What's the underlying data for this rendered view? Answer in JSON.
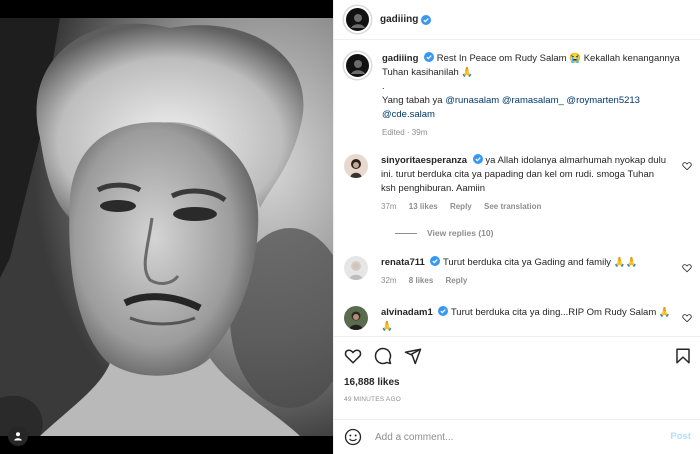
{
  "post": {
    "username": "gadiiing",
    "photo_description_icon": "tag-user-icon"
  },
  "caption": {
    "username": "gadiiing",
    "text1": "Rest In Peace om Rudy Salam 😭 Kekallah kenangannya Tuhan kasihanilah 🙏",
    "dot": ".",
    "text2": "Yang tabah ya",
    "mentions": [
      "@runasalam",
      "@ramasalam_",
      "@roymarten5213",
      "@cde.salam"
    ],
    "edited": "Edited · 39m"
  },
  "comments": [
    {
      "username": "sinyoritaesperanza",
      "text": "ya Allah idolanya almarhumah nyokap dulu ini. turut berduka cita ya papading dan kel om rudi. smoga Tuhan ksh penghiburan. Aamiin",
      "time": "37m",
      "likes": "13 likes",
      "reply": "Reply",
      "translate": "See translation"
    },
    {
      "username": "renata711",
      "text": "Turut berduka cita ya Gading and family 🙏🙏",
      "time": "32m",
      "likes": "8 likes",
      "reply": "Reply"
    },
    {
      "username": "alvinadam1",
      "text": "Turut berduka cita ya ding...RIP Om Rudy Salam 🙏🙏"
    }
  ],
  "view_replies": "View replies (10)",
  "likes_count": "16,888 likes",
  "time_ago": "49 MINUTES AGO",
  "add_comment": {
    "placeholder": "Add a comment...",
    "post_label": "Post"
  },
  "colors": {
    "verified": "#3897f0",
    "mention": "#00376b",
    "muted": "#8e8e8e",
    "post_disabled": "#b2dffc"
  }
}
